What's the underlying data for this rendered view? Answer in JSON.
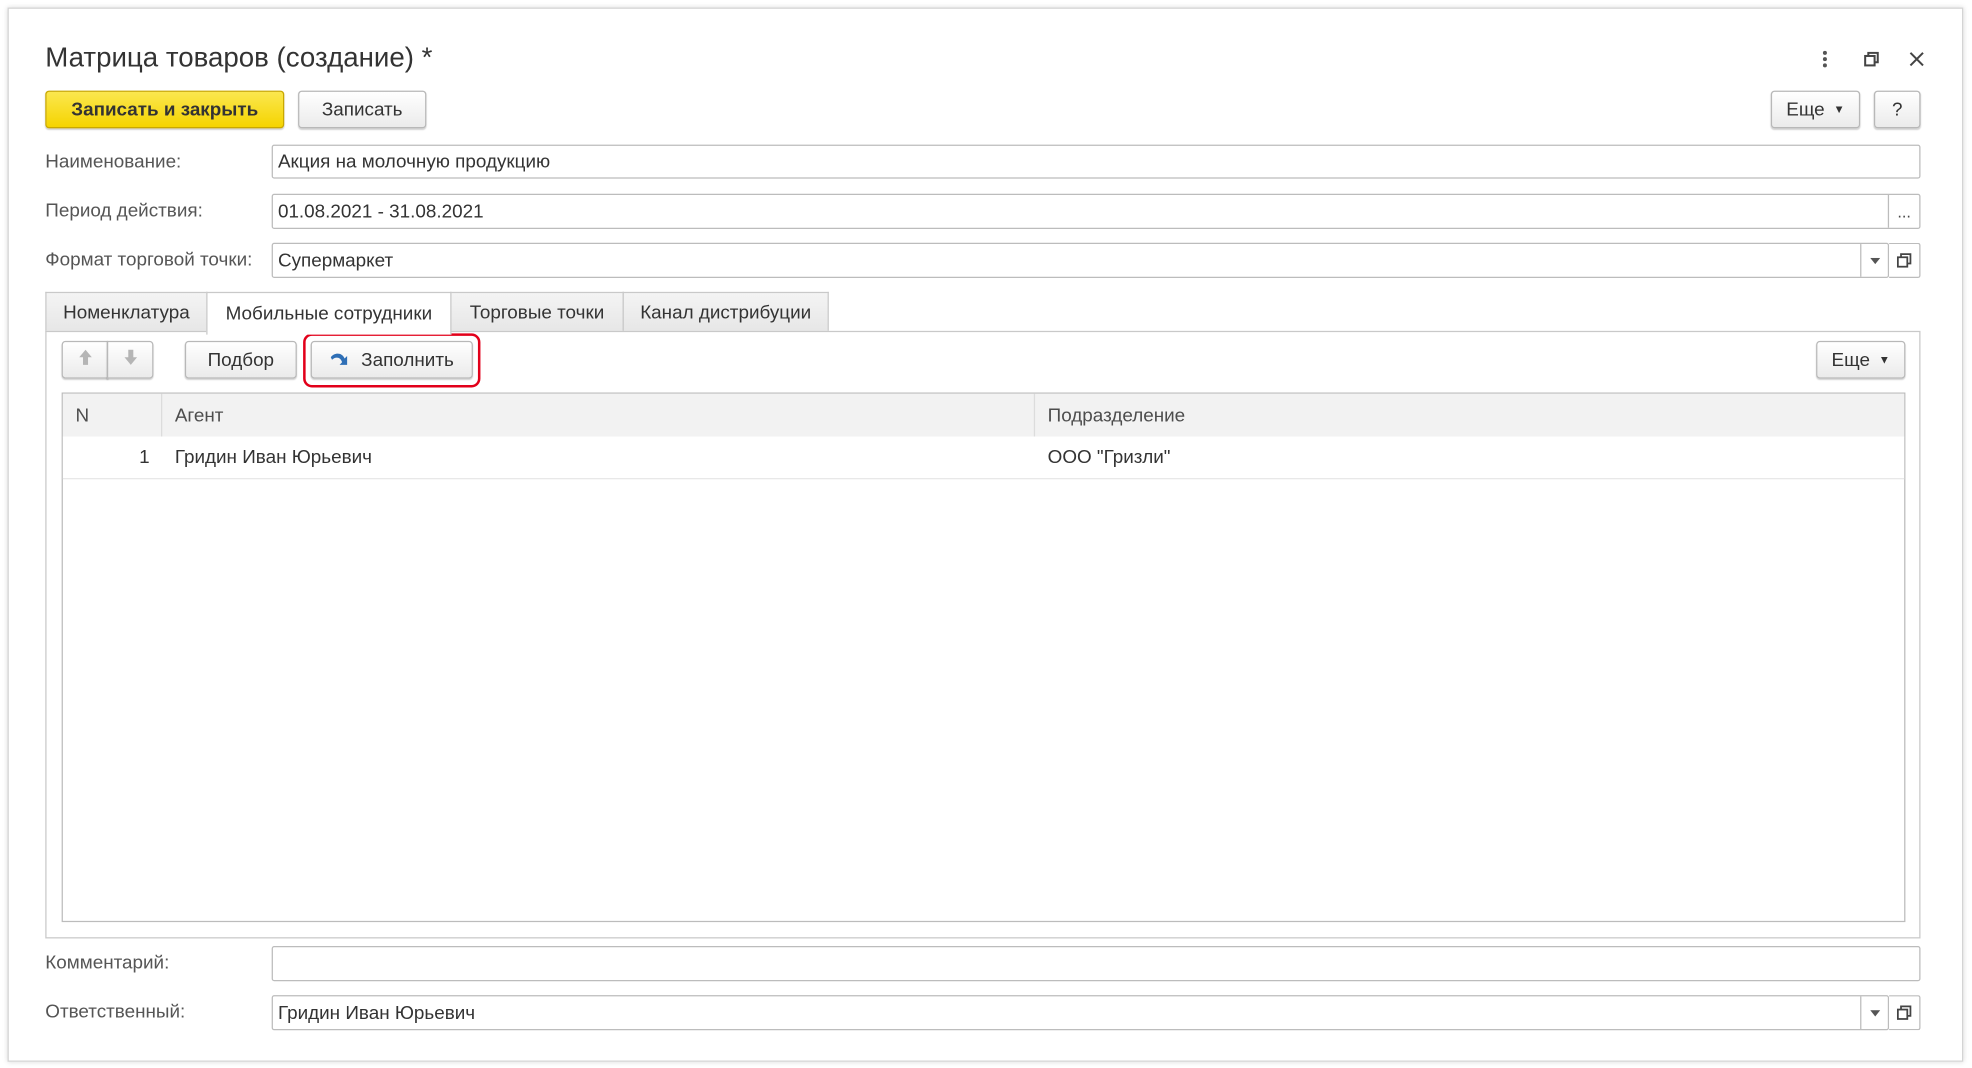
{
  "window": {
    "title": "Матрица товаров (создание) *"
  },
  "toolbar": {
    "save_close_label": "Записать и закрыть",
    "save_label": "Записать",
    "more_label": "Еще",
    "help_label": "?"
  },
  "form": {
    "name_label": "Наименование:",
    "name_value": "Акция на молочную продукцию",
    "period_label": "Период действия:",
    "period_value": "01.08.2021 - 31.08.2021",
    "period_button": "...",
    "format_label": "Формат торговой точки:",
    "format_value": "Супермаркет",
    "comment_label": "Комментарий:",
    "comment_value": "",
    "responsible_label": "Ответственный:",
    "responsible_value": "Гридин Иван Юрьевич"
  },
  "tabs": [
    {
      "label": "Номенклатура",
      "active": false
    },
    {
      "label": "Мобильные сотрудники",
      "active": true
    },
    {
      "label": "Торговые точки",
      "active": false
    },
    {
      "label": "Канал дистрибуции",
      "active": false
    }
  ],
  "table_toolbar": {
    "select_label": "Подбор",
    "fill_label": "Заполнить",
    "more_label": "Еще"
  },
  "table": {
    "columns": [
      "N",
      "Агент",
      "Подразделение"
    ],
    "rows": [
      {
        "n": "1",
        "agent": "Гридин Иван Юрьевич",
        "department": "ООО \"Гризли\""
      }
    ]
  },
  "colors": {
    "primary_button": "#f5d400",
    "highlight": "#e2001a",
    "fill_icon": "#2f6fb6"
  }
}
